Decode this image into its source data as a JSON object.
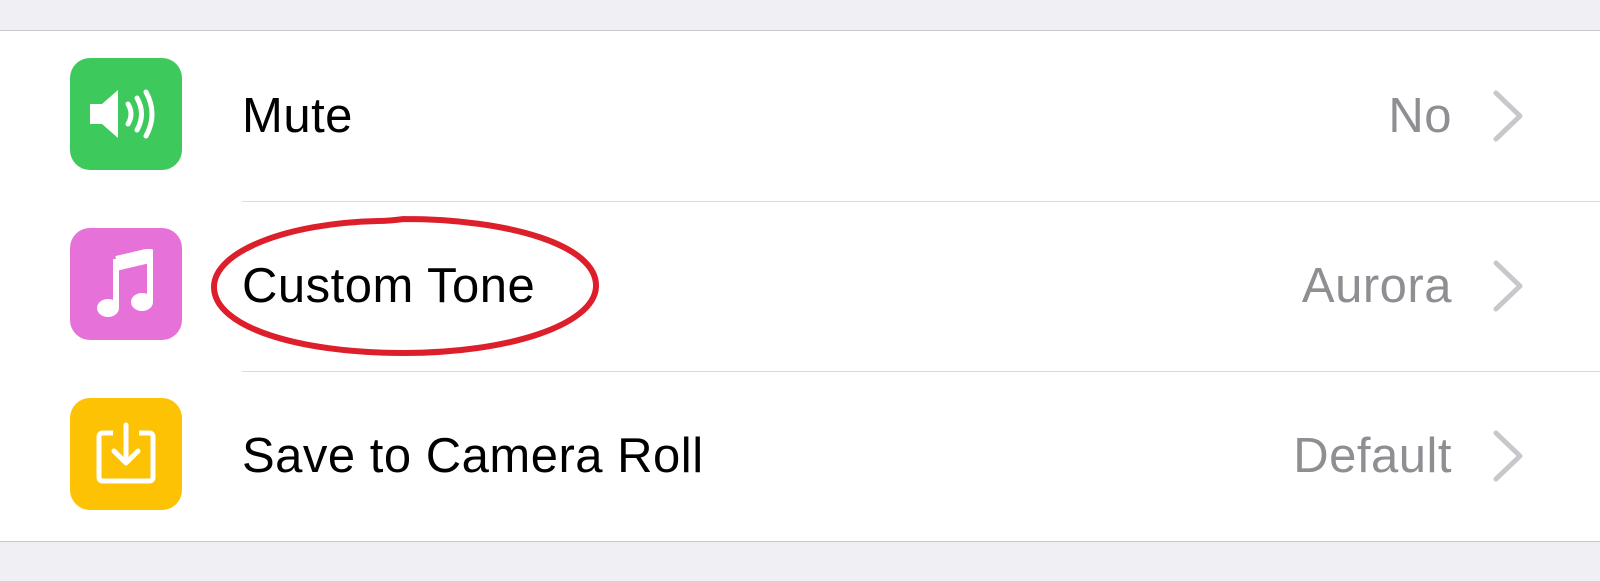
{
  "rows": [
    {
      "label": "Mute",
      "value": "No",
      "icon": "speaker-icon",
      "icon_color": "#3ec95c"
    },
    {
      "label": "Custom Tone",
      "value": "Aurora",
      "icon": "music-note-icon",
      "icon_color": "#e672d9"
    },
    {
      "label": "Save to Camera Roll",
      "value": "Default",
      "icon": "download-tray-icon",
      "icon_color": "#fec204"
    }
  ],
  "colors": {
    "background": "#efeff4",
    "annotation": "#dd1f2b",
    "value_text": "#8e8e93",
    "chevron": "#c7c7cc"
  }
}
